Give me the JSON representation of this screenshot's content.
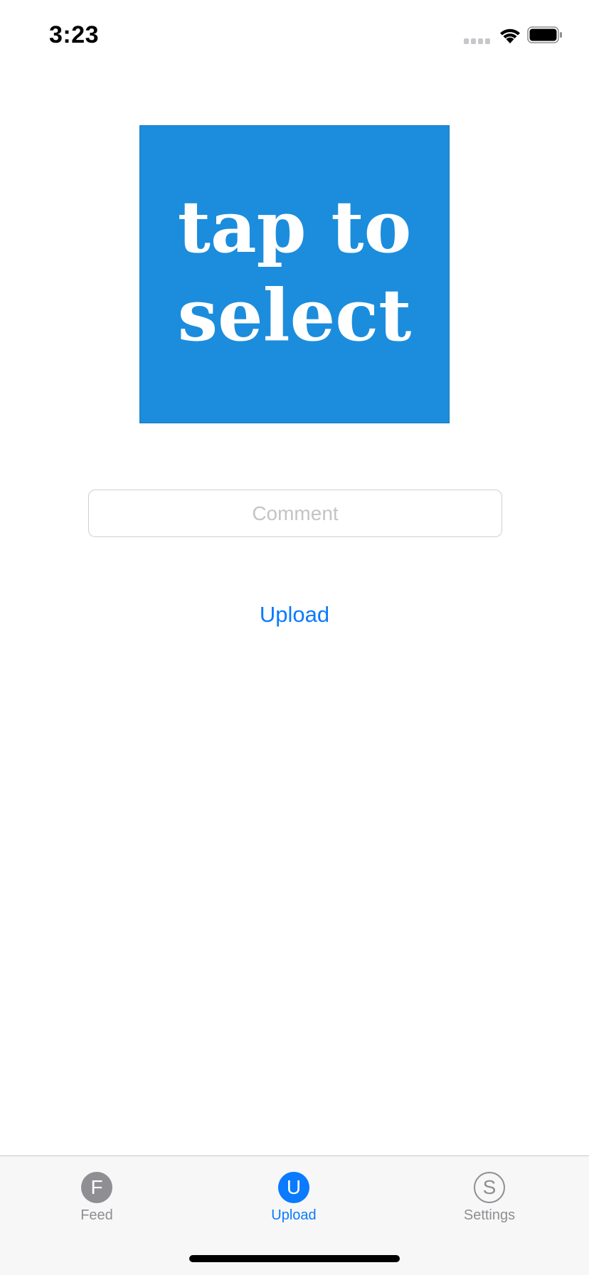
{
  "status_bar": {
    "time": "3:23",
    "icons": [
      "signal-icon",
      "wifi-icon",
      "battery-icon"
    ]
  },
  "image_picker": {
    "text": "tap to\nselect",
    "background_color": "#1b8ddc"
  },
  "comment": {
    "placeholder": "Comment",
    "value": ""
  },
  "upload_button": {
    "label": "Upload",
    "color": "#0a7aff"
  },
  "tab_bar": {
    "tabs": [
      {
        "label": "Feed",
        "icon_letter": "F",
        "icon": "feed-icon",
        "active": false
      },
      {
        "label": "Upload",
        "icon_letter": "U",
        "icon": "upload-icon",
        "active": true
      },
      {
        "label": "Settings",
        "icon_letter": "S",
        "icon": "settings-icon",
        "active": false
      }
    ],
    "active_color": "#0a7aff",
    "inactive_color": "#8e8e93"
  }
}
